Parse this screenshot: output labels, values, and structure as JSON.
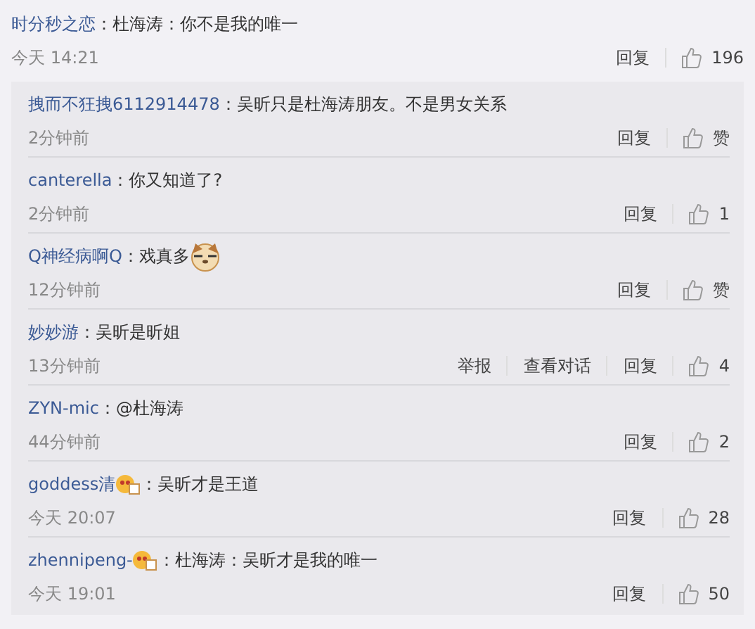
{
  "comment": {
    "user": "时分秒之恋",
    "text": "：杜海涛：你不是我的唯一",
    "time": "今天 14:21",
    "actions": [
      "回复"
    ],
    "likes": "196"
  },
  "replies": [
    {
      "user": "拽而不狂拽6112914478",
      "badge": false,
      "text": "：吴昕只是杜海涛朋友。不是男女关系",
      "emoticon": false,
      "time": "2分钟前",
      "actions": [
        "回复"
      ],
      "likes": "赞"
    },
    {
      "user": "canterella",
      "badge": false,
      "text": "：你又知道了?",
      "emoticon": false,
      "time": "2分钟前",
      "actions": [
        "回复"
      ],
      "likes": "1"
    },
    {
      "user": "Q神经病啊Q",
      "badge": false,
      "text": "：戏真多",
      "emoticon": true,
      "time": "12分钟前",
      "actions": [
        "回复"
      ],
      "likes": "赞"
    },
    {
      "user": "妙妙游",
      "badge": false,
      "text": "：吴昕是昕姐",
      "emoticon": false,
      "time": "13分钟前",
      "actions": [
        "举报",
        "查看对话",
        "回复"
      ],
      "likes": "4"
    },
    {
      "user": "ZYN-mic",
      "badge": false,
      "text": "：@杜海涛",
      "emoticon": false,
      "time": "44分钟前",
      "actions": [
        "回复"
      ],
      "likes": "2"
    },
    {
      "user": "goddess清",
      "badge": true,
      "text": "：吴昕才是王道",
      "emoticon": false,
      "time": "今天 20:07",
      "actions": [
        "回复"
      ],
      "likes": "28"
    },
    {
      "user": "zhennipeng-",
      "badge": true,
      "text": "：杜海涛：吴昕才是我的唯一",
      "emoticon": false,
      "time": "今天 19:01",
      "actions": [
        "回复"
      ],
      "likes": "50"
    }
  ]
}
